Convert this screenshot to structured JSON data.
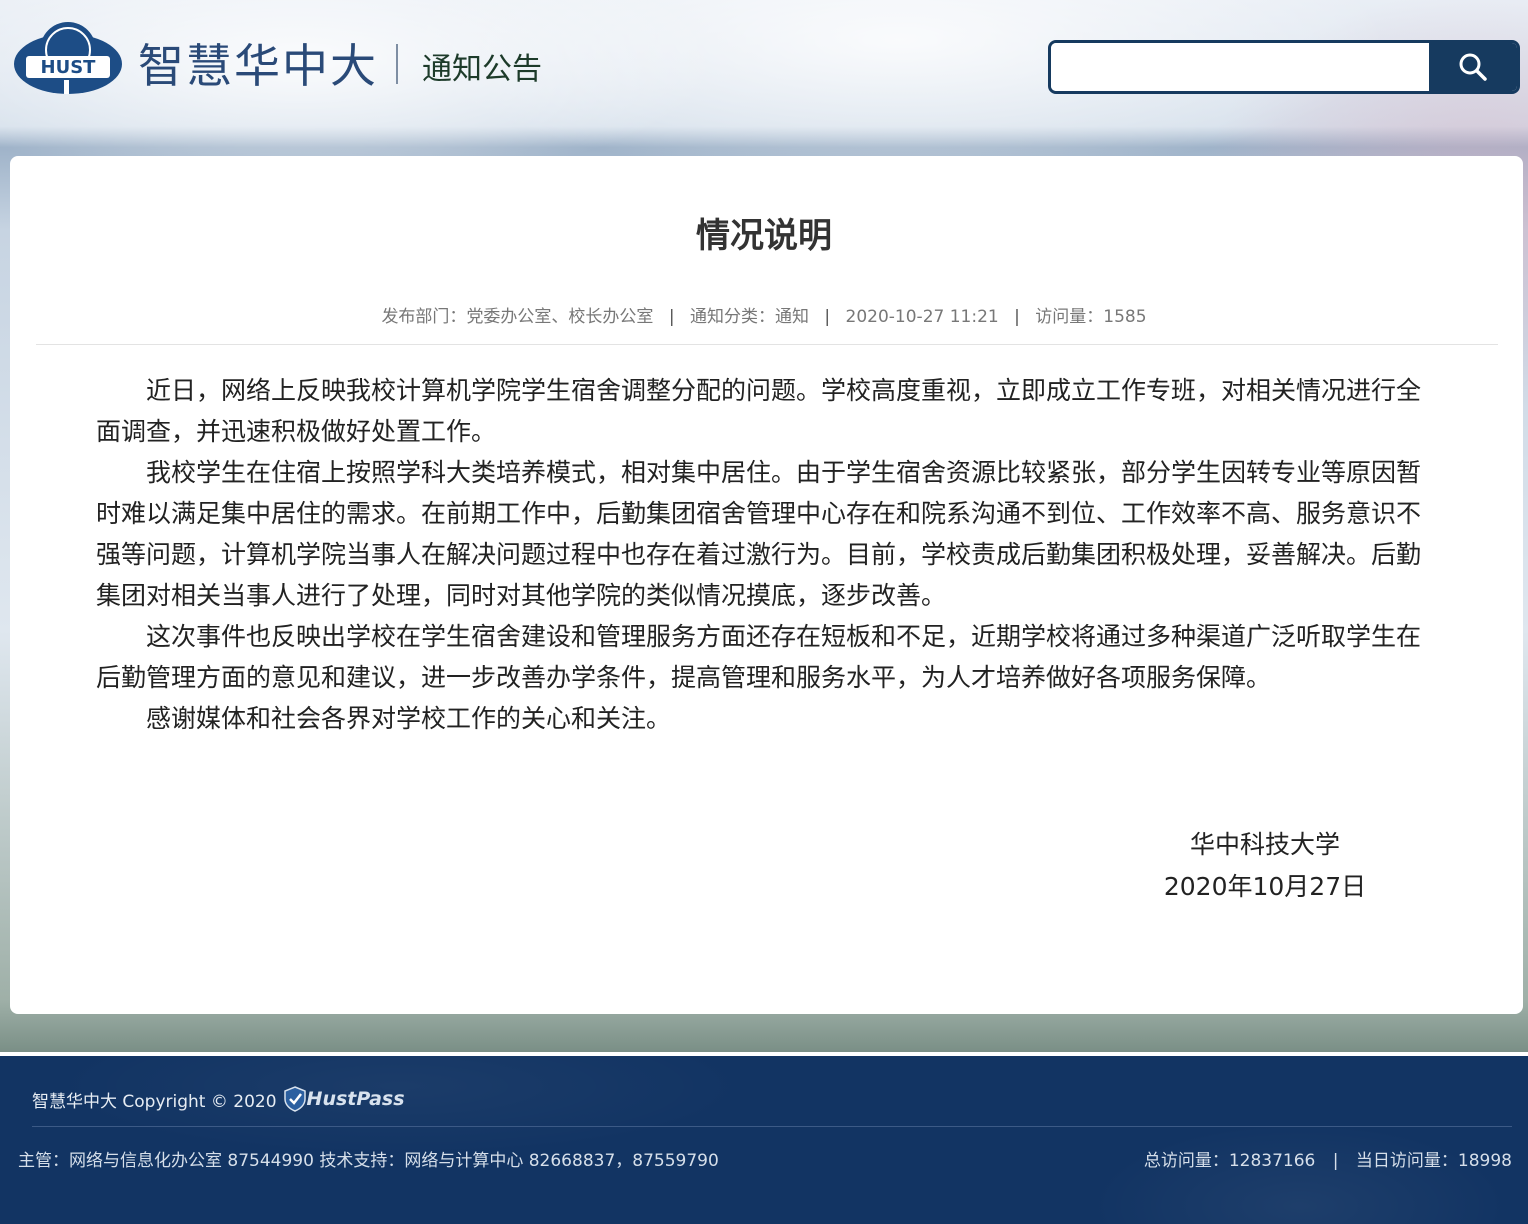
{
  "header": {
    "logo_text": "HUST",
    "brand": "智慧华中大",
    "section": "通知公告",
    "search": {
      "placeholder": ""
    }
  },
  "article": {
    "title": "情况说明",
    "meta": {
      "department_label": "发布部门：",
      "department": "党委办公室、校长办公室",
      "category_label": "通知分类：",
      "category": "通知",
      "datetime": "2020-10-27 11:21",
      "views_label": "访问量：",
      "views": "1585"
    },
    "paragraphs": [
      "近日，网络上反映我校计算机学院学生宿舍调整分配的问题。学校高度重视，立即成立工作专班，对相关情况进行全面调查，并迅速积极做好处置工作。",
      "我校学生在住宿上按照学科大类培养模式，相对集中居住。由于学生宿舍资源比较紧张，部分学生因转专业等原因暂时难以满足集中居住的需求。在前期工作中，后勤集团宿舍管理中心存在和院系沟通不到位、工作效率不高、服务意识不强等问题，计算机学院当事人在解决问题过程中也存在着过激行为。目前，学校责成后勤集团积极处理，妥善解决。后勤集团对相关当事人进行了处理，同时对其他学院的类似情况摸底，逐步改善。",
      "这次事件也反映出学校在学生宿舍建设和管理服务方面还存在短板和不足，近期学校将通过多种渠道广泛听取学生在后勤管理方面的意见和建议，进一步改善办学条件，提高管理和服务水平，为人才培养做好各项服务保障。",
      "感谢媒体和社会各界对学校工作的关心和关注。"
    ],
    "signature": {
      "org": "华中科技大学",
      "date": "2020年10月27日"
    }
  },
  "footer": {
    "copyright": "智慧华中大 Copyright © 2020",
    "hustpass": "HustPass",
    "admin": "主管：网络与信息化办公室 87544990  技术支持：网络与计算中心 82668837，87559790",
    "total_visits_label": "总访问量：",
    "total_visits": "12837166",
    "today_visits_label": "当日访问量：",
    "today_visits": "18998"
  },
  "colors": {
    "brand_blue": "#2a4a78",
    "search_dark": "#163a5f",
    "footer_bg": "#123463"
  }
}
